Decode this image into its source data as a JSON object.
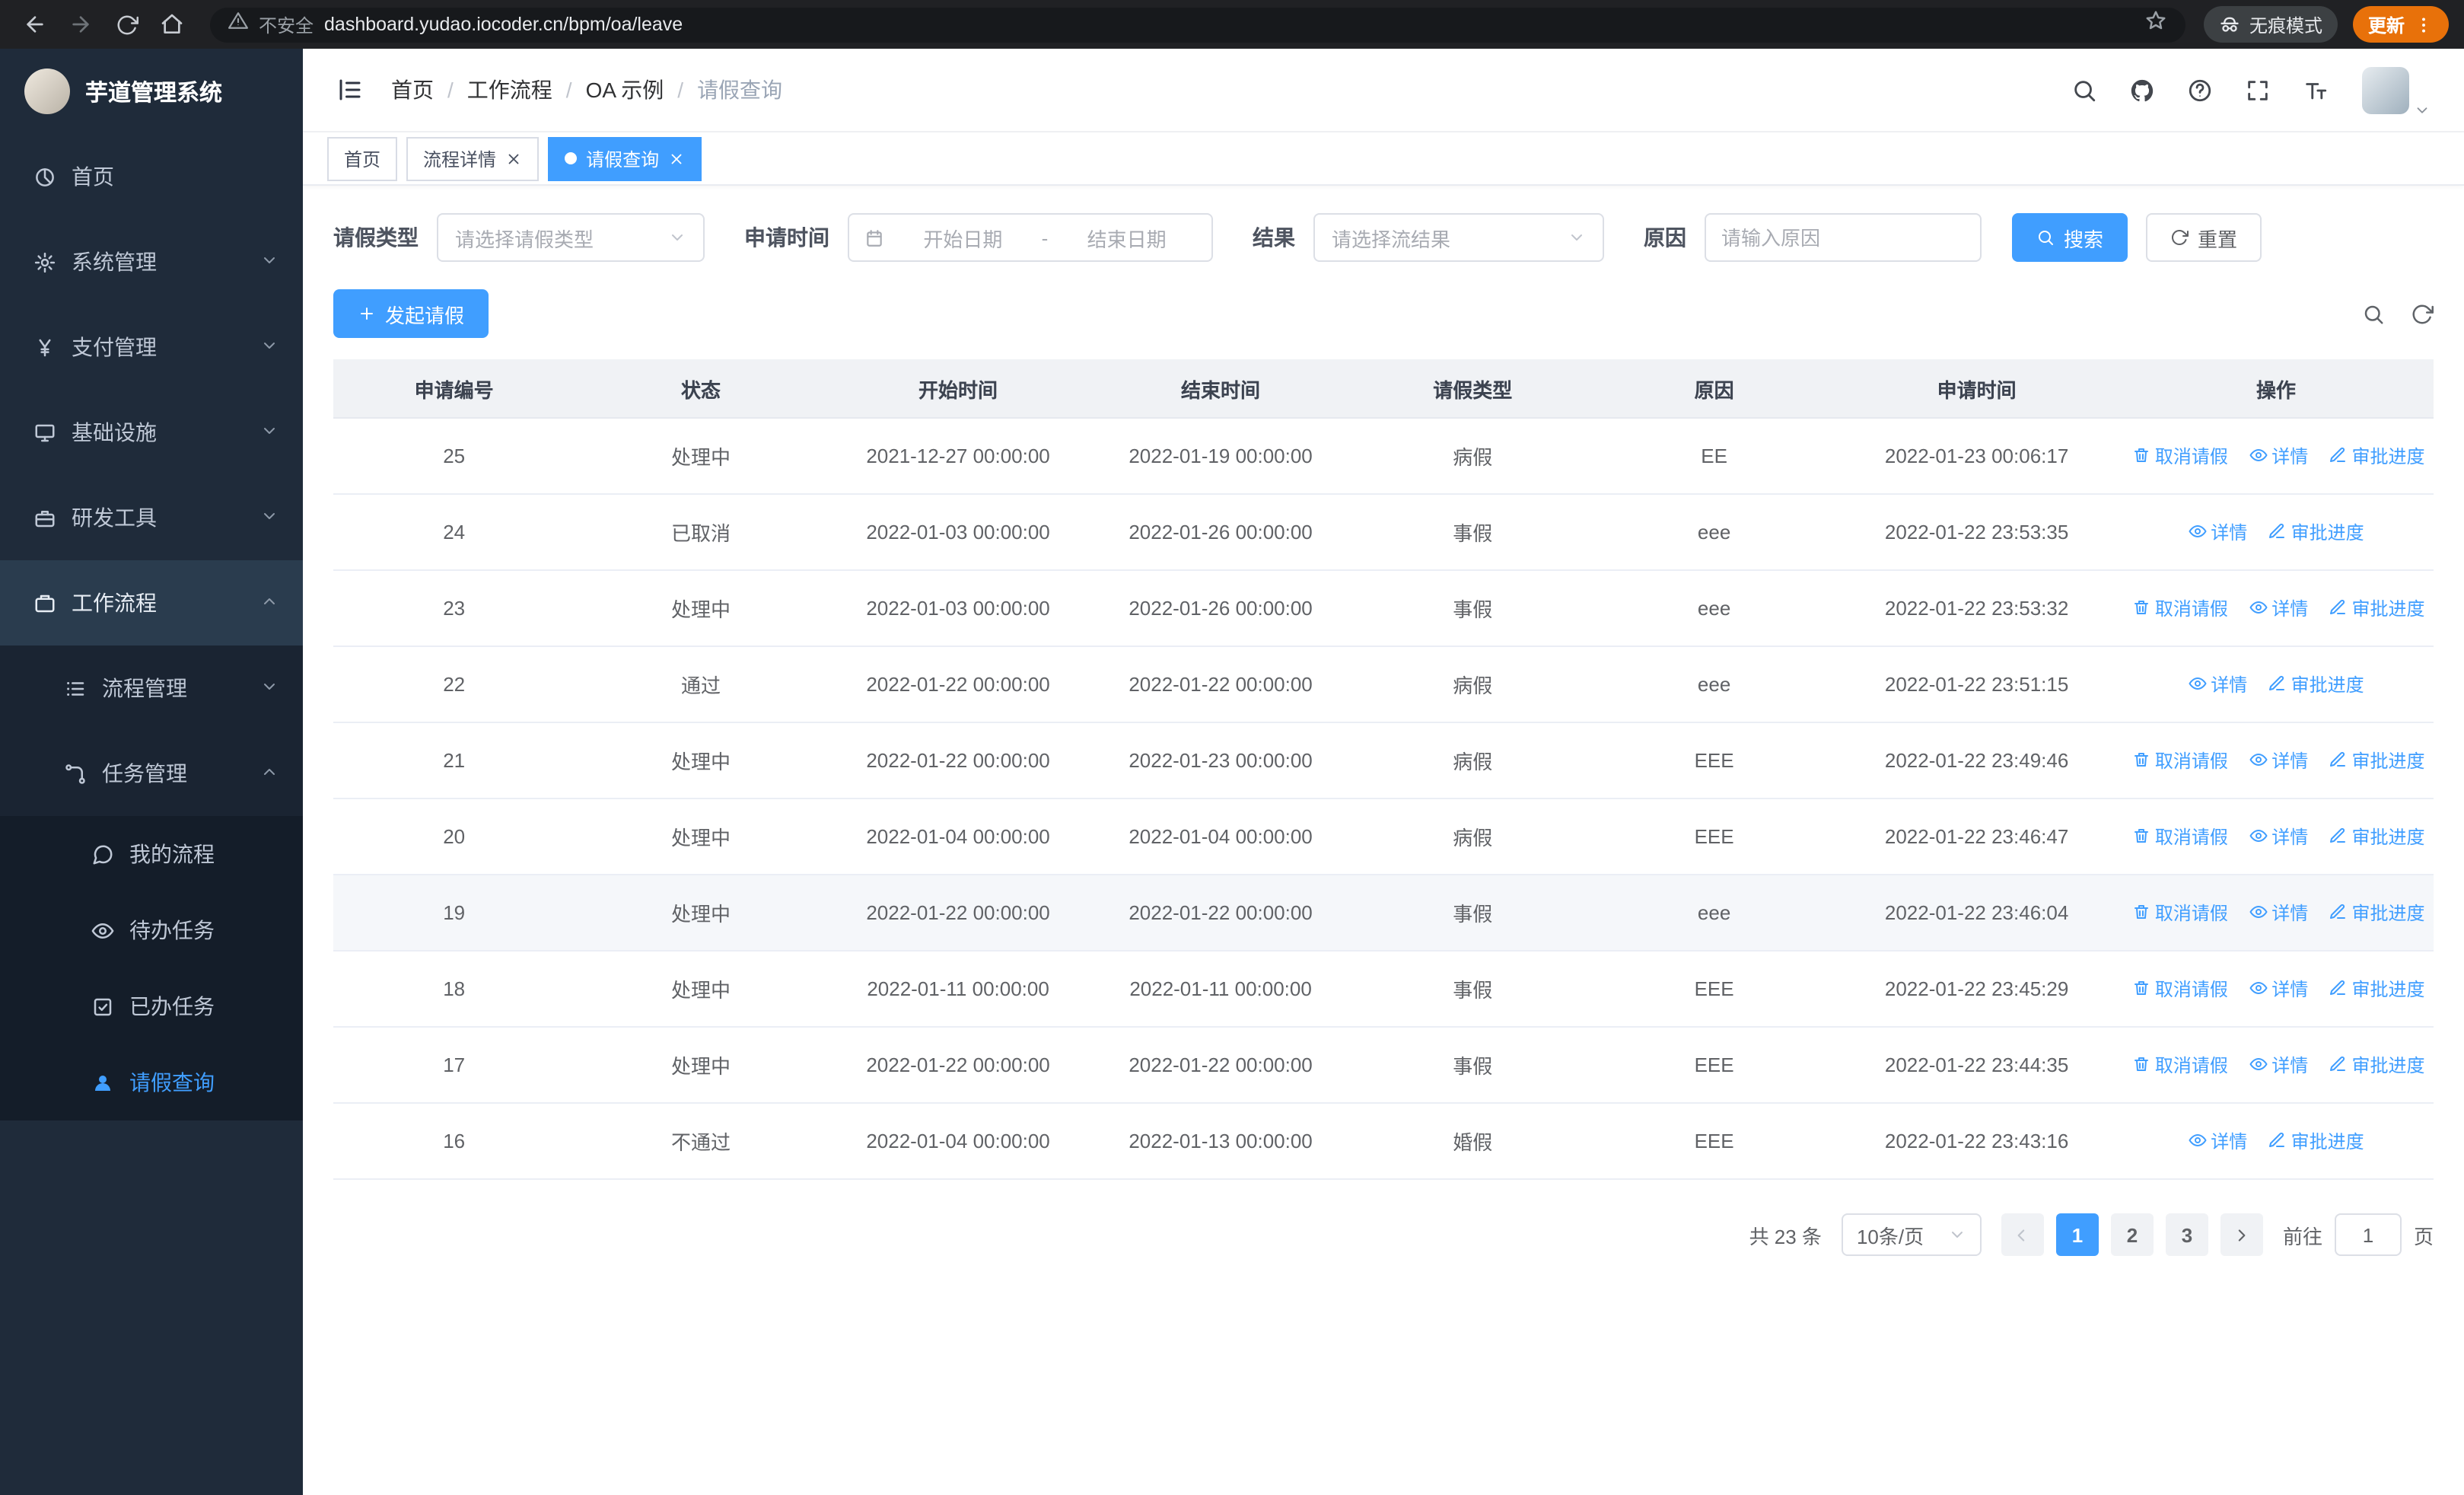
{
  "colors": {
    "accent": "#409eff",
    "sidebar_bg": "#1f2b3a",
    "update_chip": "#e8710a",
    "table_header_bg": "#f0f2f5"
  },
  "icons": {
    "back": "arrow-left",
    "forward": "arrow-right",
    "reload": "circular-arrow",
    "home": "house",
    "warning": "triangle-exclamation",
    "bookmark": "star-outline",
    "incognito": "spy-glasses",
    "kebab": "vertical-dots",
    "menu_fold": "lines-with-bar",
    "search": "magnifier",
    "github": "octocat",
    "help": "question-circle",
    "fullscreen": "corner-arrows",
    "font_size": "letter-T",
    "calendar": "calendar-grid",
    "chevron": "chevron",
    "plus": "plus-sign",
    "cancel_action": "trash-can",
    "detail_action": "eye",
    "progress_action": "pen",
    "home_menu": "pie-chart",
    "system": "gear",
    "payment": "yen-sign",
    "infra": "monitor",
    "devtools": "toolbox",
    "workflow": "briefcase",
    "process": "list-lines",
    "task": "flow-branch",
    "my_process": "chat-bubble",
    "todo": "eye",
    "done": "check-square",
    "leave": "user-solid"
  },
  "browser": {
    "security_warning": "不安全",
    "url": "dashboard.yudao.iocoder.cn/bpm/oa/leave",
    "incognito_label": "无痕模式",
    "update_label": "更新"
  },
  "sidebar": {
    "app_title": "芋道管理系统",
    "items": [
      {
        "label": "首页"
      },
      {
        "label": "系统管理"
      },
      {
        "label": "支付管理"
      },
      {
        "label": "基础设施"
      },
      {
        "label": "研发工具"
      },
      {
        "label": "工作流程"
      },
      {
        "label": "流程管理"
      },
      {
        "label": "任务管理"
      },
      {
        "label": "我的流程"
      },
      {
        "label": "待办任务"
      },
      {
        "label": "已办任务"
      },
      {
        "label": "请假查询"
      }
    ]
  },
  "breadcrumb": {
    "items": [
      "首页",
      "工作流程",
      "OA 示例",
      "请假查询"
    ],
    "separator": "/"
  },
  "tabs": {
    "items": [
      {
        "label": "首页",
        "closable": false,
        "active": false
      },
      {
        "label": "流程详情",
        "closable": true,
        "active": false
      },
      {
        "label": "请假查询",
        "closable": true,
        "active": true
      }
    ]
  },
  "filters": {
    "leave_type_label": "请假类型",
    "leave_type_placeholder": "请选择请假类型",
    "apply_time_label": "申请时间",
    "date_start_placeholder": "开始日期",
    "date_separator": "-",
    "date_end_placeholder": "结束日期",
    "result_label": "结果",
    "result_placeholder": "请选择流结果",
    "reason_label": "原因",
    "reason_placeholder": "请输入原因",
    "search_button": "搜索",
    "reset_button": "重置"
  },
  "toolbar": {
    "create_button": "发起请假"
  },
  "table": {
    "columns": [
      "申请编号",
      "状态",
      "开始时间",
      "结束时间",
      "请假类型",
      "原因",
      "申请时间",
      "操作"
    ],
    "action_labels": {
      "cancel": "取消请假",
      "detail": "详情",
      "progress": "审批进度"
    },
    "rows": [
      {
        "id": "25",
        "status": "处理中",
        "start": "2021-12-27 00:00:00",
        "end": "2022-01-19 00:00:00",
        "type": "病假",
        "reason": "EE",
        "apply_time": "2022-01-23 00:06:17",
        "actions": [
          "cancel",
          "detail",
          "progress"
        ]
      },
      {
        "id": "24",
        "status": "已取消",
        "start": "2022-01-03 00:00:00",
        "end": "2022-01-26 00:00:00",
        "type": "事假",
        "reason": "eee",
        "apply_time": "2022-01-22 23:53:35",
        "actions": [
          "detail",
          "progress"
        ]
      },
      {
        "id": "23",
        "status": "处理中",
        "start": "2022-01-03 00:00:00",
        "end": "2022-01-26 00:00:00",
        "type": "事假",
        "reason": "eee",
        "apply_time": "2022-01-22 23:53:32",
        "actions": [
          "cancel",
          "detail",
          "progress"
        ]
      },
      {
        "id": "22",
        "status": "通过",
        "start": "2022-01-22 00:00:00",
        "end": "2022-01-22 00:00:00",
        "type": "病假",
        "reason": "eee",
        "apply_time": "2022-01-22 23:51:15",
        "actions": [
          "detail",
          "progress"
        ]
      },
      {
        "id": "21",
        "status": "处理中",
        "start": "2022-01-22 00:00:00",
        "end": "2022-01-23 00:00:00",
        "type": "病假",
        "reason": "EEE",
        "apply_time": "2022-01-22 23:49:46",
        "actions": [
          "cancel",
          "detail",
          "progress"
        ]
      },
      {
        "id": "20",
        "status": "处理中",
        "start": "2022-01-04 00:00:00",
        "end": "2022-01-04 00:00:00",
        "type": "病假",
        "reason": "EEE",
        "apply_time": "2022-01-22 23:46:47",
        "actions": [
          "cancel",
          "detail",
          "progress"
        ]
      },
      {
        "id": "19",
        "status": "处理中",
        "start": "2022-01-22 00:00:00",
        "end": "2022-01-22 00:00:00",
        "type": "事假",
        "reason": "eee",
        "apply_time": "2022-01-22 23:46:04",
        "actions": [
          "cancel",
          "detail",
          "progress"
        ]
      },
      {
        "id": "18",
        "status": "处理中",
        "start": "2022-01-11 00:00:00",
        "end": "2022-01-11 00:00:00",
        "type": "事假",
        "reason": "EEE",
        "apply_time": "2022-01-22 23:45:29",
        "actions": [
          "cancel",
          "detail",
          "progress"
        ]
      },
      {
        "id": "17",
        "status": "处理中",
        "start": "2022-01-22 00:00:00",
        "end": "2022-01-22 00:00:00",
        "type": "事假",
        "reason": "EEE",
        "apply_time": "2022-01-22 23:44:35",
        "actions": [
          "cancel",
          "detail",
          "progress"
        ]
      },
      {
        "id": "16",
        "status": "不通过",
        "start": "2022-01-04 00:00:00",
        "end": "2022-01-13 00:00:00",
        "type": "婚假",
        "reason": "EEE",
        "apply_time": "2022-01-22 23:43:16",
        "actions": [
          "detail",
          "progress"
        ]
      }
    ]
  },
  "pagination": {
    "total_text": "共 23 条",
    "page_size": "10条/页",
    "pages": [
      "1",
      "2",
      "3"
    ],
    "active_page": "1",
    "goto_label": "前往",
    "goto_value": "1",
    "goto_suffix": "页"
  }
}
